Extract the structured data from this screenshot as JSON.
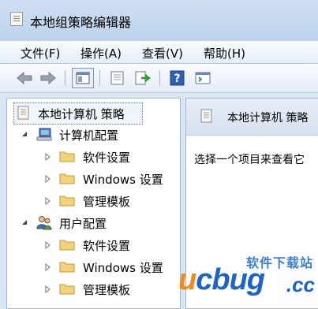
{
  "window": {
    "title": "本地组策略编辑器"
  },
  "menu": {
    "file": "文件(F)",
    "action": "操作(A)",
    "view": "查看(V)",
    "help": "帮助(H)"
  },
  "toolbar": {
    "icons": [
      "back-arrow-icon",
      "forward-arrow-icon",
      "show-hide-tree-icon",
      "properties-icon",
      "export-list-icon",
      "help-icon",
      "console-icon"
    ]
  },
  "tree": {
    "root": "本地计算机 策略",
    "computer_config": "计算机配置",
    "computer_children": [
      "软件设置",
      "Windows 设置",
      "管理模板"
    ],
    "user_config": "用户配置",
    "user_children": [
      "软件设置",
      "Windows 设置",
      "管理模板"
    ]
  },
  "details": {
    "title": "本地计算机 策略",
    "description": "选择一个项目来查看它"
  },
  "watermark": {
    "site_name": "软件下载站",
    "brand_u": "u",
    "brand_c": "c",
    "brand_rest": "bug",
    "domain": ".cc"
  },
  "colors": {
    "titlebar": "#bcd2ec",
    "selection": "#f0f5fb",
    "folder": "#f2d27a",
    "brand_blue": "#1e63c8",
    "brand_orange": "#f08a1c"
  }
}
